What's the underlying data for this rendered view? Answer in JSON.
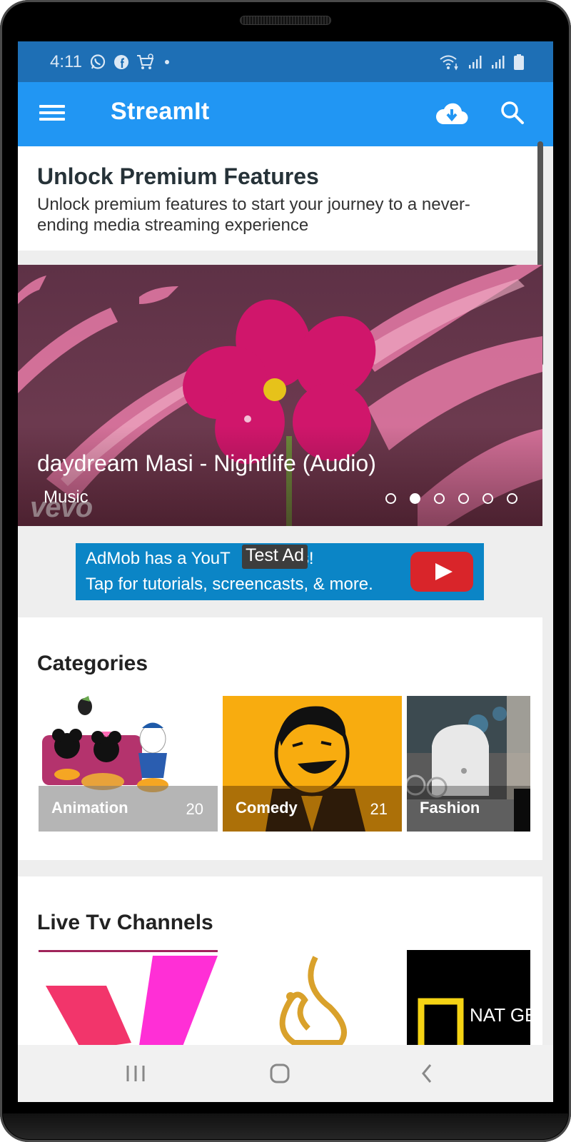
{
  "status_bar": {
    "time": "4:11",
    "notification_icons": [
      "whatsapp-icon",
      "facebook-icon",
      "shopping-cart-icon",
      "dot-icon"
    ],
    "system_icons": [
      "wifi-icon",
      "signal-icon",
      "signal-icon",
      "battery-icon"
    ]
  },
  "app_bar": {
    "title": "StreamIt",
    "actions": [
      "menu-icon",
      "cloud-download-icon",
      "search-icon"
    ],
    "color": "#2196f3"
  },
  "premium": {
    "title": "Unlock Premium Features",
    "description": "Unlock premium features to start your journey to a never-ending media streaming experience"
  },
  "slider": {
    "title": "daydream Masi - Nightlife (Audio)",
    "category": "Music",
    "watermark": "vevo",
    "slide_count": 6,
    "active_index": 1
  },
  "ad": {
    "line1_start": "AdMob has a YouT",
    "line1_end": "s!",
    "line2": "Tap for tutorials, screencasts, & more.",
    "badge": "Test Ad",
    "color": "#0b85c6"
  },
  "categories": {
    "title": "Categories",
    "items": [
      {
        "label": "Animation",
        "count": "20"
      },
      {
        "label": "Comedy",
        "count": "21"
      },
      {
        "label": "Fashion",
        "count": ""
      }
    ]
  },
  "live_tv": {
    "title": "Live Tv Channels",
    "channels": [
      {
        "name": "pink-v-logo"
      },
      {
        "name": "al-jazeera-logo"
      },
      {
        "name": "nat-geo-wild-logo",
        "text": "NAT GE"
      }
    ]
  },
  "nav_bar": {
    "buttons": [
      "recents-icon",
      "home-icon",
      "back-icon"
    ]
  }
}
